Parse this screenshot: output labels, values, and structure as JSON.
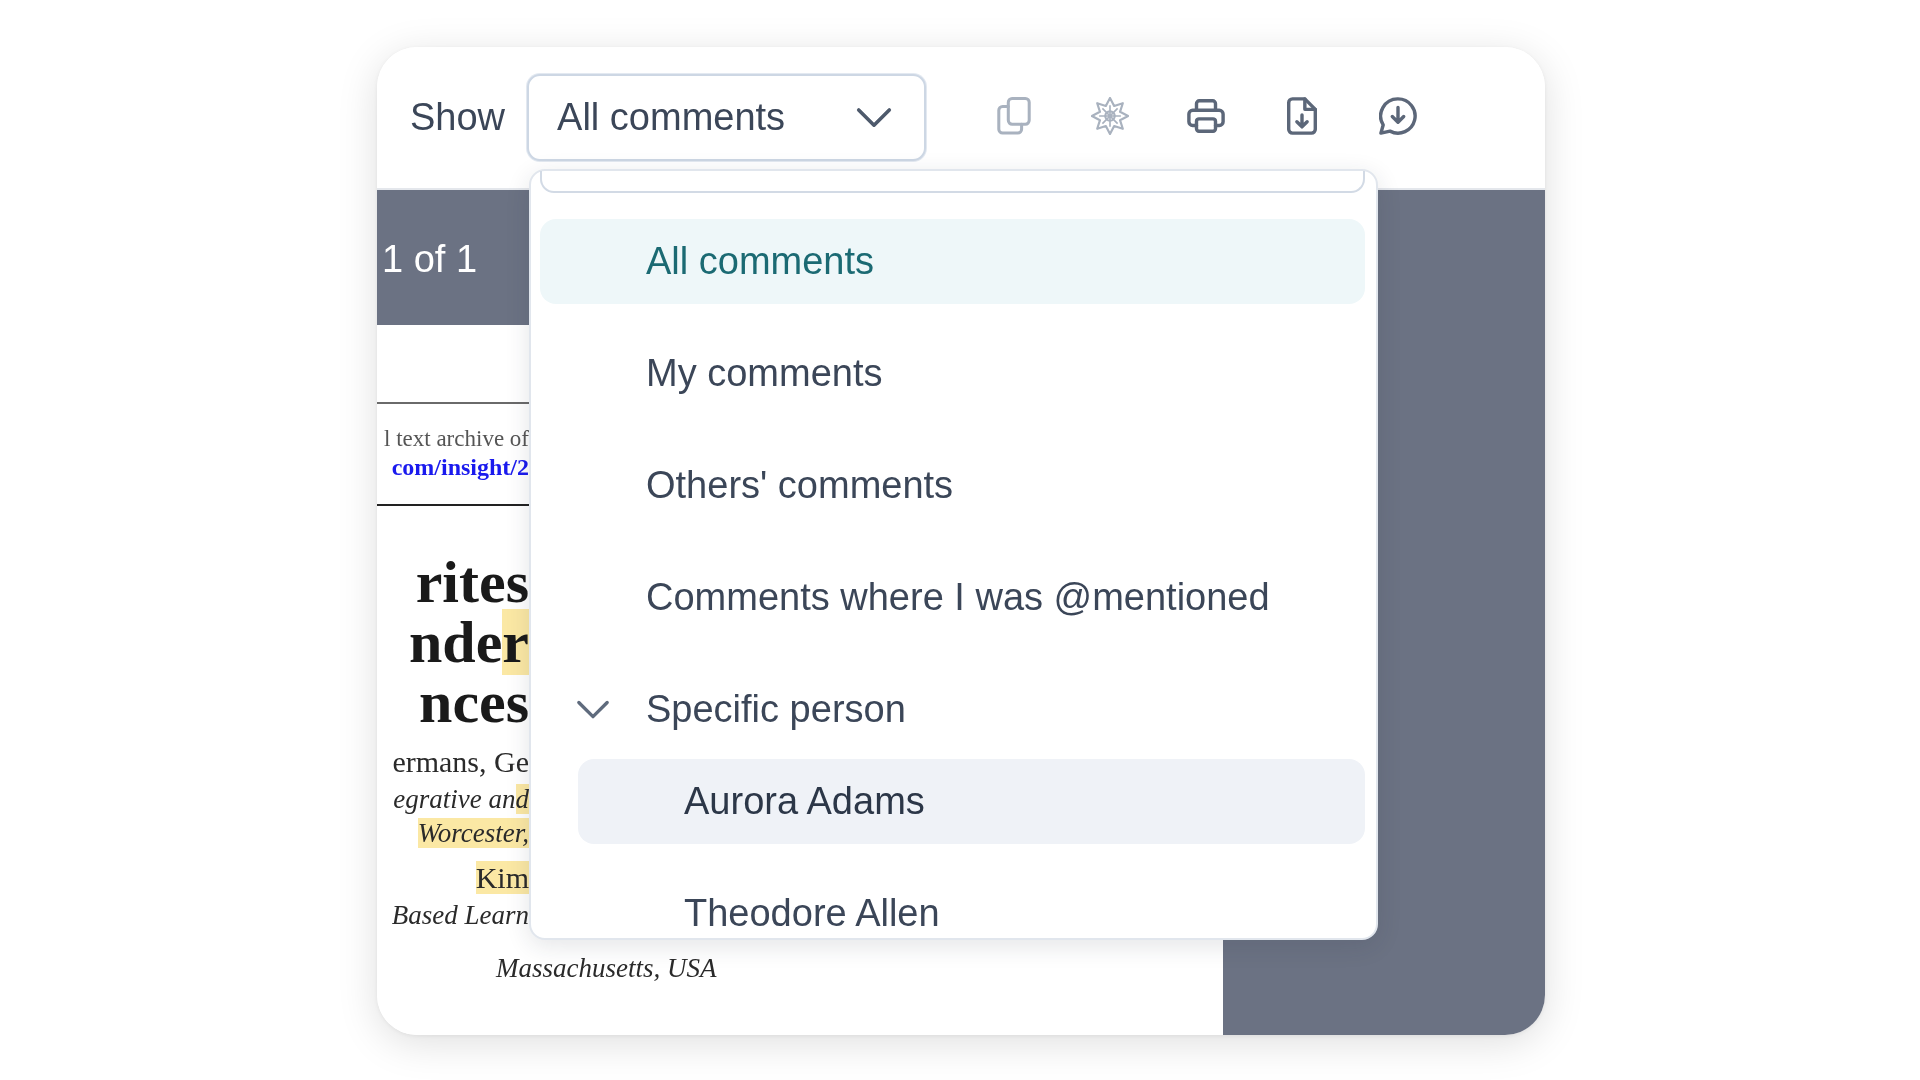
{
  "toolbar": {
    "filter": {
      "label": "Show",
      "value": "All comments",
      "open": true
    },
    "tools": [
      {
        "kind": "copy",
        "disabled": true
      },
      {
        "kind": "starburst",
        "disabled": true
      },
      {
        "kind": "print",
        "disabled": false
      },
      {
        "kind": "file-download",
        "disabled": false
      },
      {
        "kind": "chat-download",
        "disabled": false
      }
    ]
  },
  "menu": {
    "items": [
      {
        "kind": "option",
        "label": "All comments",
        "selected": true,
        "highlighted": false
      },
      {
        "kind": "option",
        "label": "My comments",
        "selected": false,
        "highlighted": false
      },
      {
        "kind": "option",
        "label": "Others' comments",
        "selected": false,
        "highlighted": false
      },
      {
        "kind": "option",
        "label": "Comments where I was @mentioned",
        "selected": false,
        "highlighted": false
      },
      {
        "kind": "group",
        "label": "Specific person",
        "selected": false,
        "highlighted": false,
        "expanded": true,
        "children": [
          {
            "label": "Aurora Adams",
            "selected": false,
            "highlighted": true
          },
          {
            "label": "Theodore Allen",
            "selected": false,
            "highlighted": false
          }
        ]
      }
    ]
  },
  "viewer": {
    "page_indicator": "1 of 1",
    "document": {
      "header_lines": [
        {
          "kind": "note",
          "segments": [
            {
              "text": "l text archive of",
              "highlighted": false
            }
          ]
        },
        {
          "kind": "link",
          "segments": [
            {
              "text": "com/insight/2",
              "highlighted": false
            }
          ]
        }
      ],
      "lines": [
        {
          "kind": "heading",
          "segments": [
            {
              "text": "rites",
              "highlighted": false
            }
          ]
        },
        {
          "kind": "heading",
          "segments": [
            {
              "text": "nde",
              "highlighted": false
            },
            {
              "text": "r",
              "highlighted": true
            }
          ]
        },
        {
          "kind": "heading",
          "segments": [
            {
              "text": "nces",
              "highlighted": false
            }
          ]
        },
        {
          "kind": "author",
          "segments": [
            {
              "text": "ermans, Ge",
              "highlighted": false
            }
          ]
        },
        {
          "kind": "affiliation",
          "segments": [
            {
              "text": "egrative an",
              "highlighted": false
            },
            {
              "text": "d",
              "highlighted": true
            }
          ]
        },
        {
          "kind": "affiliation",
          "segments": [
            {
              "text": "Worcester,",
              "highlighted": true
            }
          ]
        },
        {
          "kind": "author",
          "segments": [
            {
              "text": "Kim",
              "highlighted": true
            }
          ]
        },
        {
          "kind": "affiliation",
          "segments": [
            {
              "text": "Based Learn",
              "highlighted": false
            }
          ]
        }
      ],
      "bottom_line": "Massachusetts, USA"
    }
  }
}
